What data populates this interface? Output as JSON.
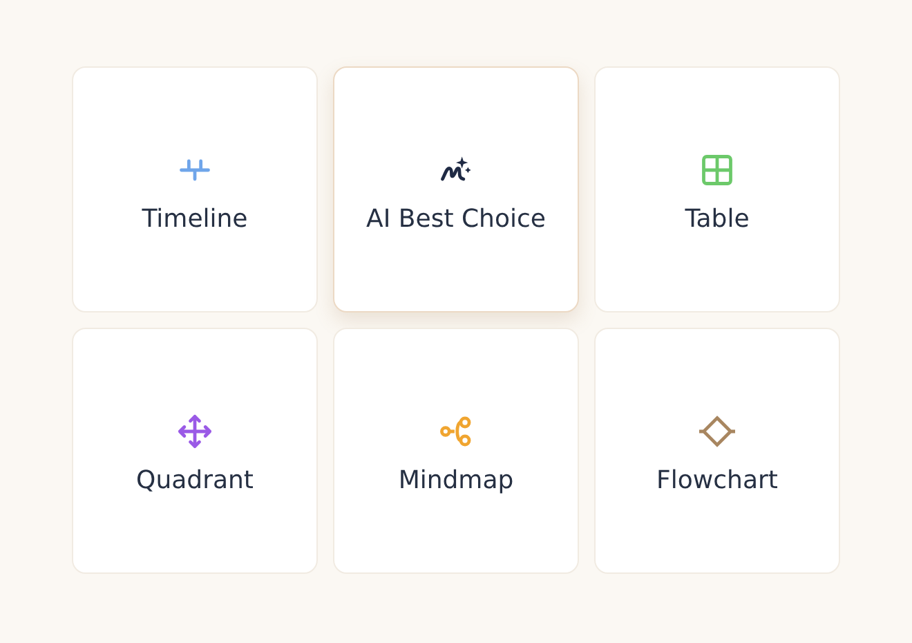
{
  "options": [
    {
      "kind": "timeline",
      "label": "Timeline",
      "color": "#6fa5ea",
      "selected": false
    },
    {
      "kind": "ai",
      "label": "AI Best Choice",
      "color": "#1f2a44",
      "selected": true
    },
    {
      "kind": "table",
      "label": "Table",
      "color": "#6cc96a",
      "selected": false
    },
    {
      "kind": "quadrant",
      "label": "Quadrant",
      "color": "#9a5ae6",
      "selected": false
    },
    {
      "kind": "mindmap",
      "label": "Mindmap",
      "color": "#f0a530",
      "selected": false
    },
    {
      "kind": "flowchart",
      "label": "Flowchart",
      "color": "#a88660",
      "selected": false
    }
  ]
}
